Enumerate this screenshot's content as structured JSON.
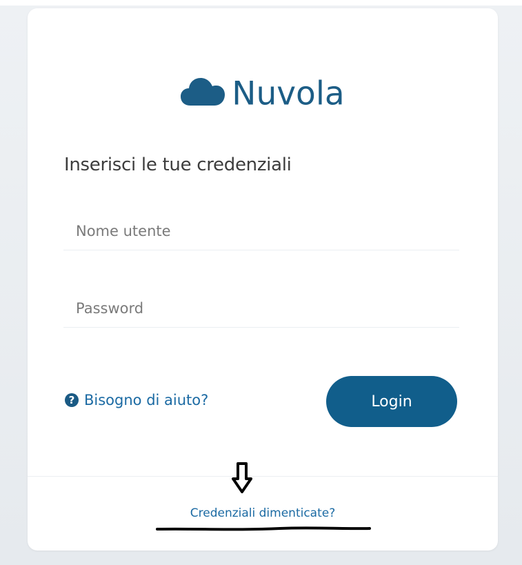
{
  "logo": {
    "text": "Nuvola",
    "icon": "cloud-icon",
    "color": "#1c5d86"
  },
  "login_form": {
    "heading": "Inserisci le tue credenziali",
    "username_placeholder": "Nome utente",
    "password_placeholder": "Password",
    "help_link": "Bisogno di aiuto?",
    "help_icon": "question-circle-icon",
    "login_button": "Login",
    "forgot_link": "Credenziali dimenticate?",
    "accent_color": "#115e8b"
  },
  "annotations": {
    "arrow_icon": "arrow-down-icon"
  }
}
